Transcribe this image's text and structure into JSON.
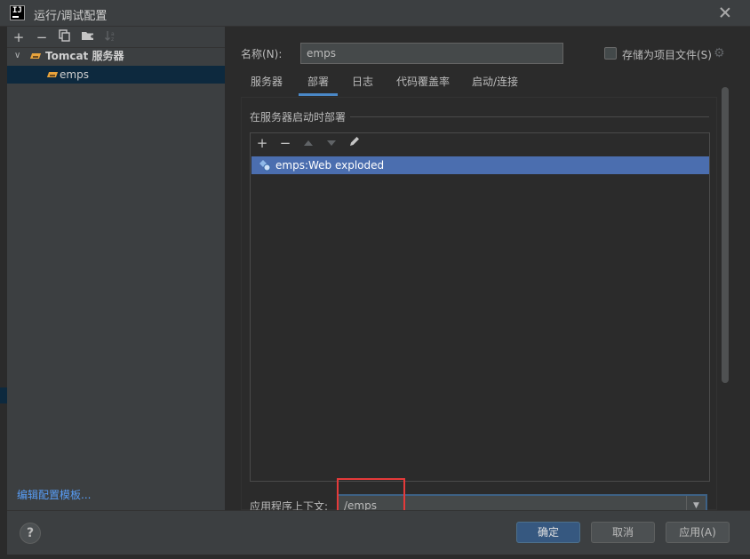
{
  "window": {
    "title": "运行/调试配置"
  },
  "sidebar": {
    "tree": [
      {
        "label": "Tomcat 服务器",
        "expanded": true
      },
      {
        "label": "emps",
        "selected": true
      }
    ],
    "edit_templates_link": "编辑配置模板..."
  },
  "form": {
    "name_label": "名称(N):",
    "name_value": "emps",
    "store_as_project_file_label": "存储为项目文件(S)",
    "store_as_project_file_checked": false
  },
  "tabs": [
    {
      "label": "服务器",
      "active": false
    },
    {
      "label": "部署",
      "active": true
    },
    {
      "label": "日志",
      "active": false
    },
    {
      "label": "代码覆盖率",
      "active": false
    },
    {
      "label": "启动/连接",
      "active": false
    }
  ],
  "deployment": {
    "section_title": "在服务器启动时部署",
    "items": [
      {
        "label": "emps:Web exploded",
        "selected": true
      }
    ],
    "app_context_label": "应用程序上下文:",
    "app_context_value": "/emps"
  },
  "footer": {
    "ok_label": "确定",
    "cancel_label": "取消",
    "apply_label": "应用(A)"
  },
  "colors": {
    "accent": "#4b6eaf",
    "primary_button": "#365880",
    "highlight": "#e53a3a",
    "link": "#589df6"
  }
}
